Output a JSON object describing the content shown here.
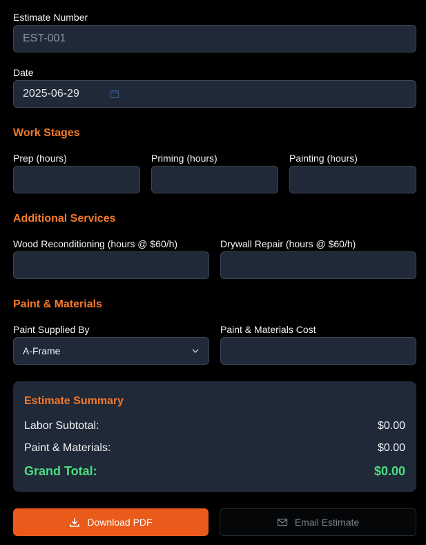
{
  "estimate_number": {
    "label": "Estimate Number",
    "placeholder": "EST-001"
  },
  "date": {
    "label": "Date",
    "value": "2025-06-29",
    "icon": "calendar-icon"
  },
  "work_stages": {
    "title": "Work Stages",
    "prep_label": "Prep (hours)",
    "priming_label": "Priming (hours)",
    "painting_label": "Painting (hours)"
  },
  "additional_services": {
    "title": "Additional Services",
    "wood_label": "Wood Reconditioning (hours @ $60/h)",
    "drywall_label": "Drywall Repair (hours @ $60/h)"
  },
  "paint_materials": {
    "title": "Paint & Materials",
    "supplied_by_label": "Paint Supplied By",
    "supplied_by_value": "A-Frame",
    "cost_label": "Paint & Materials Cost"
  },
  "summary": {
    "title": "Estimate Summary",
    "labor_label": "Labor Subtotal:",
    "labor_value": "$0.00",
    "paint_label": "Paint & Materials:",
    "paint_value": "$0.00",
    "grand_label": "Grand Total:",
    "grand_value": "$0.00"
  },
  "actions": {
    "download_label": "Download PDF",
    "email_label": "Email Estimate"
  },
  "colors": {
    "accent": "#f47a2a",
    "primary_button": "#ea5a1a",
    "grand_total": "#4ade80",
    "panel": "#1f2937"
  }
}
